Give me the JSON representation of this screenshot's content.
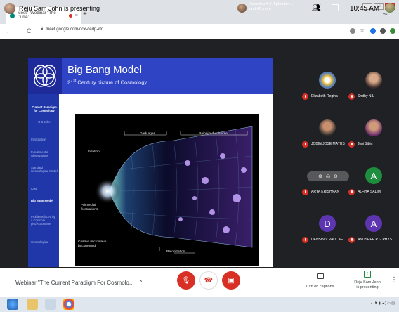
{
  "browser": {
    "tab_title": "Meet - Webinar \"The Curre:",
    "tab_close": "×",
    "new_tab": "+",
    "url": "meet.google.com/dcx-cedp-ktd",
    "back": "←",
    "forward": "→",
    "reload": "C",
    "window_controls": [
      "–",
      "□",
      "×"
    ]
  },
  "meet_top": {
    "presenter_text": "Reju Sam John is presenting",
    "attendee_text_1": "Anandhu A.J ,Splendor ...",
    "attendee_text_2": "and 45 more",
    "people_count": "47",
    "clock": "10:45 AM",
    "you_label": "You"
  },
  "slide": {
    "title": "Big Bang Model",
    "subtitle_sup": "st",
    "subtitle_pre": "21",
    "subtitle_post": " Century picture of Cosmology",
    "nav_header": "Current Paradigm for Cosmology",
    "nav_author": "R S John",
    "nav_items": [
      {
        "label": "Introduction"
      },
      {
        "label": "Fundamental Observations"
      },
      {
        "label": "Standard Cosmological Model"
      },
      {
        "label": "CMB"
      },
      {
        "label": "Big Bang Model"
      },
      {
        "label": "Problems faced by a Cosmolo gist/Astronome"
      },
      {
        "label": "Cosmological"
      }
    ],
    "figure_labels": {
      "dark_ages": "Dark ages",
      "reionized": "Reionized universe",
      "inflation": "Inflation",
      "primordial": "Primordial fluctuations",
      "cmb": "Cosmic microwave background",
      "reionization": "Reionization"
    }
  },
  "participants": [
    {
      "name": "Elizabeth Regina",
      "avatar": "flower-photo"
    },
    {
      "name": "Sruthy N.L",
      "avatar": "person-photo"
    },
    {
      "name": "JOBIN JOSE MATHS",
      "avatar": "person-photo"
    },
    {
      "name": "Jimi Sibin",
      "avatar": "person-photo"
    },
    {
      "name": "ARYA KRISHNAN",
      "avatar": "person-photo"
    },
    {
      "name": "ALFIYA SALIM",
      "avatar_letter": "A",
      "color": "#1e8e3e"
    },
    {
      "name": "DENSIN V PAUL AE1...",
      "avatar_letter": "D",
      "color": "#5e35b1"
    },
    {
      "name": "ANUSREE P G PHYS",
      "avatar_letter": "A",
      "color": "#5e35b1"
    }
  ],
  "bottom": {
    "meeting_title": "Webinar \"The Current Paradigm For Cosmolo...",
    "chevron": "^",
    "captions_label": "Turn on captions",
    "presenting_label_1": "Reju Sam John",
    "presenting_label_2": "is presenting",
    "more": "⋮"
  },
  "colors": {
    "meet_dark": "#202124",
    "slide_blue": "#2e44c4",
    "mute_red": "#d93025",
    "accent_green": "#1e8e3e"
  }
}
